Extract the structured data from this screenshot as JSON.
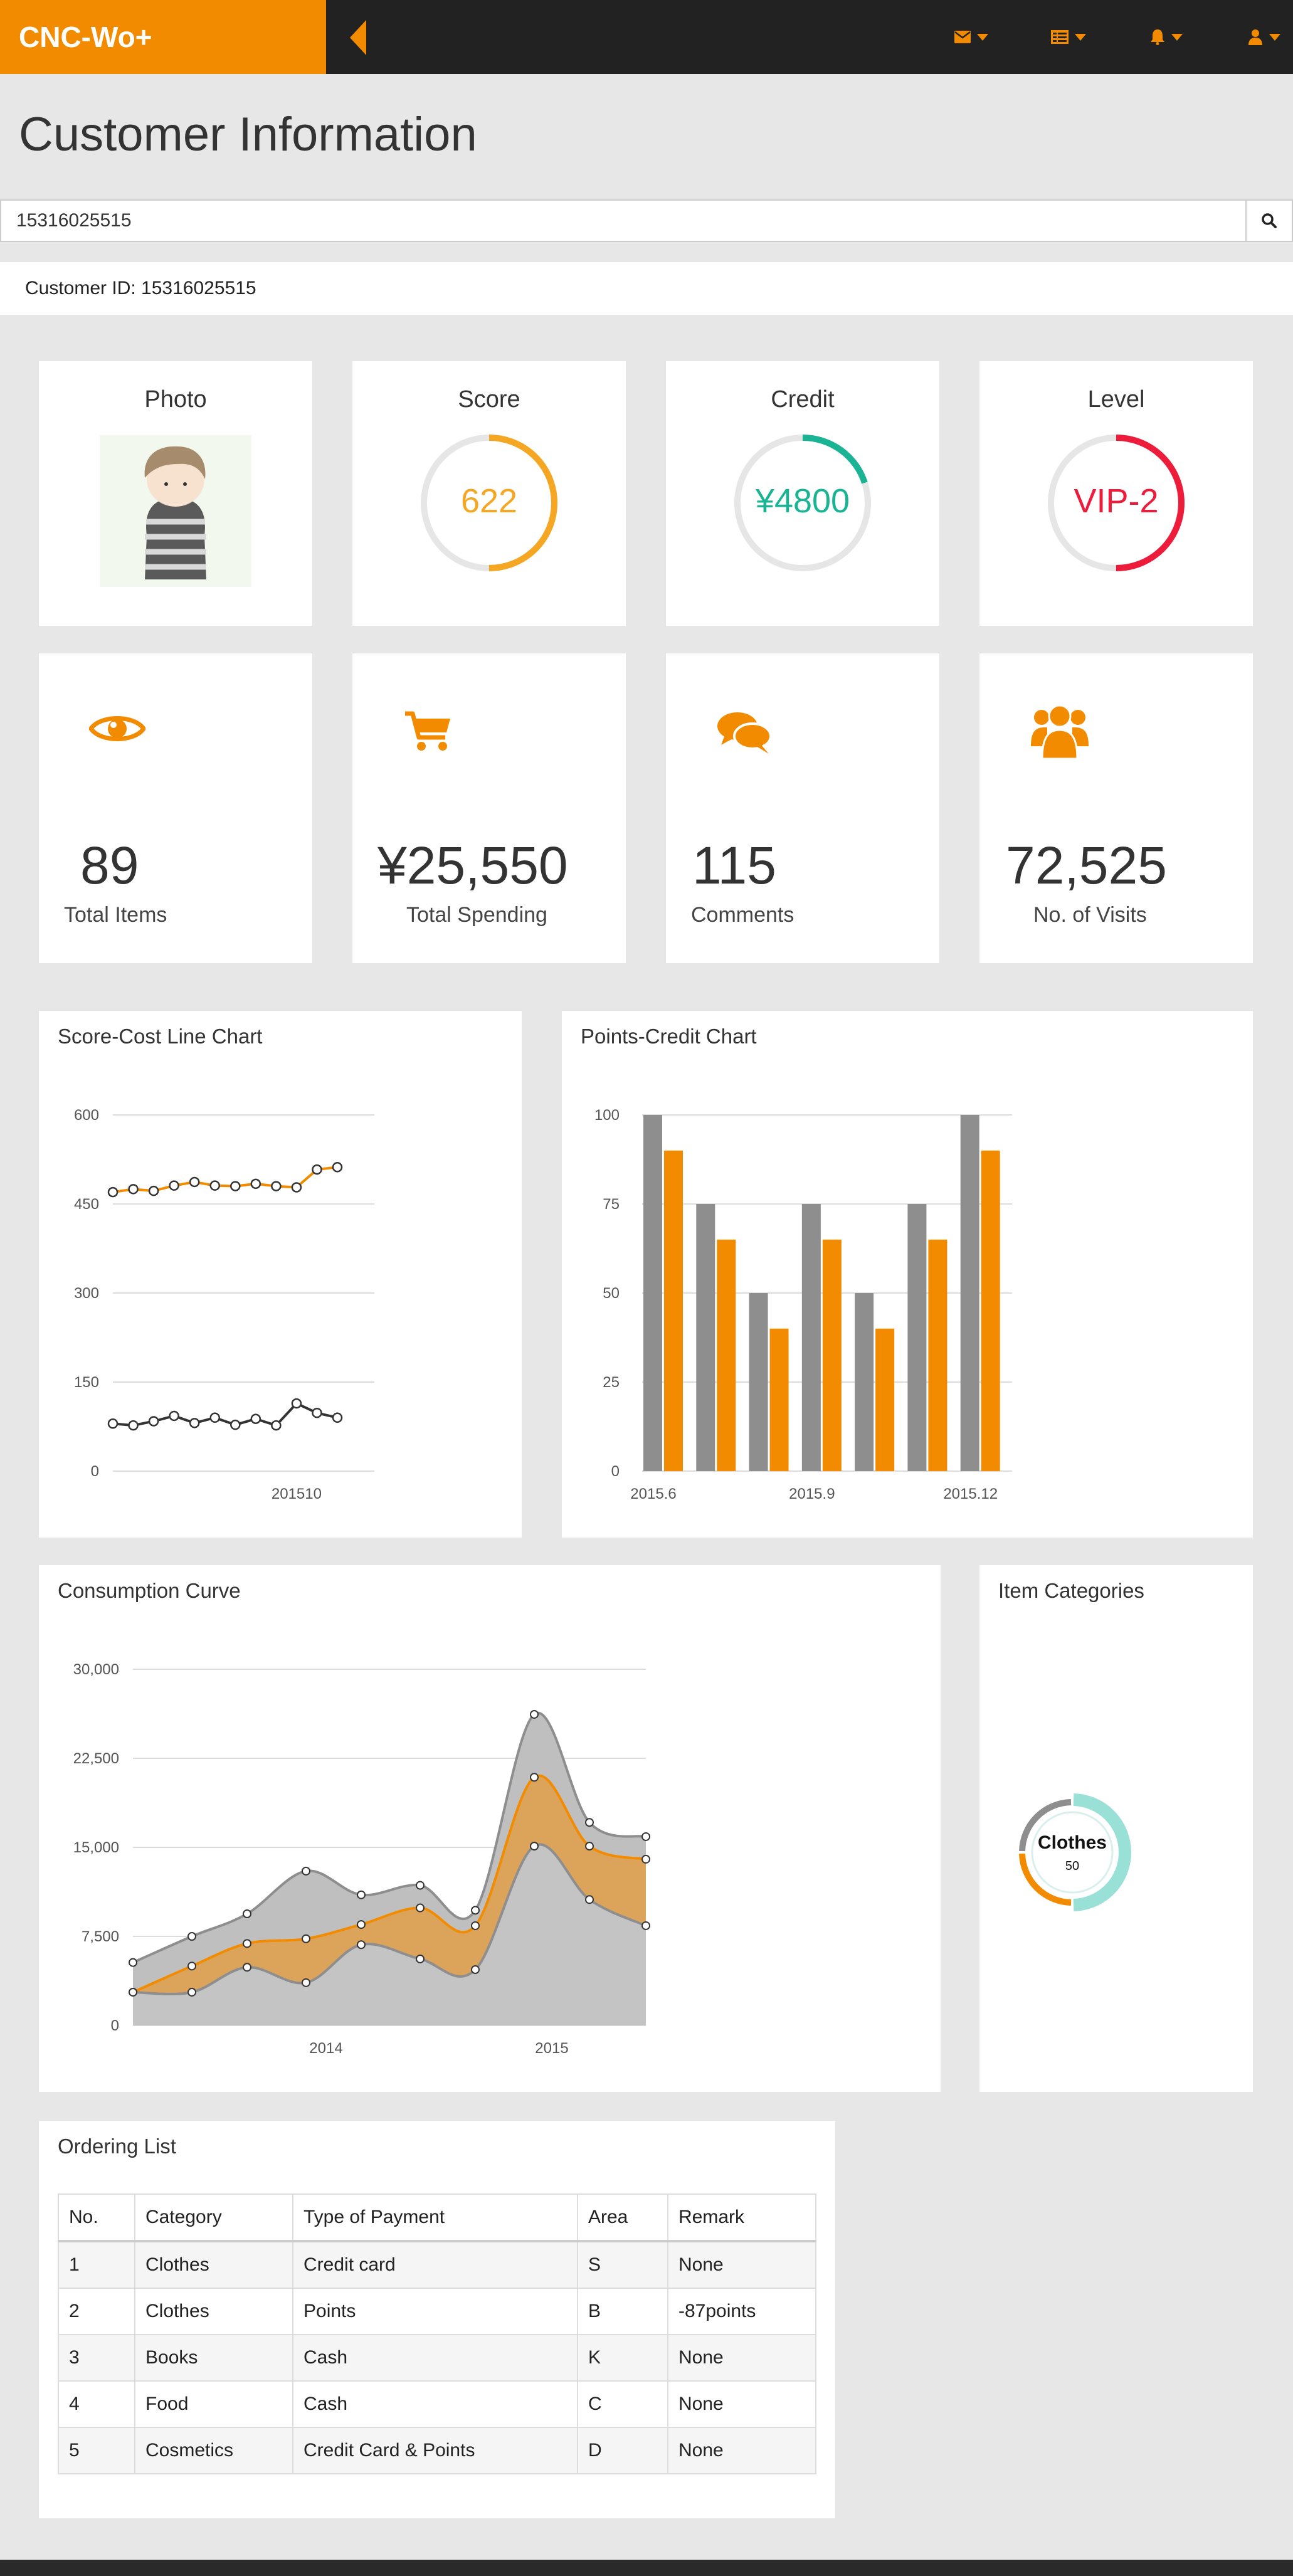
{
  "app": {
    "brand": "CNC-Wo+"
  },
  "nav": {
    "icons": [
      "envelope-icon",
      "list-icon",
      "bell-icon",
      "user-icon"
    ]
  },
  "page": {
    "title": "Customer Information"
  },
  "search": {
    "value": "15316025515"
  },
  "customer": {
    "id_text": "Customer ID: 15316025515"
  },
  "stats": {
    "photo": {
      "label": "Photo"
    },
    "score": {
      "label": "Score",
      "value": "622",
      "fraction": 0.5,
      "color": "#f5a623"
    },
    "credit": {
      "label": "Credit",
      "value": "¥4800",
      "fraction": 0.2,
      "color": "#1ab394"
    },
    "level": {
      "label": "Level",
      "value": "VIP-2",
      "fraction": 0.5,
      "color": "#ed1c3b"
    }
  },
  "metrics": [
    {
      "icon": "eye-icon",
      "value": "89",
      "label": "Total Items"
    },
    {
      "icon": "shopping-cart-icon",
      "value": "¥25,550",
      "label": "Total Spending"
    },
    {
      "icon": "comments-icon",
      "value": "115",
      "label": "Comments"
    },
    {
      "icon": "users-icon",
      "value": "72,525",
      "label": "No. of Visits"
    }
  ],
  "colors": {
    "accent": "#f28b00",
    "gray": "#8e8e8e",
    "dark": "#222222"
  },
  "chart_data": [
    {
      "type": "line",
      "title": "Score-Cost Line Chart",
      "ylim": [
        0,
        600
      ],
      "yticks": [
        0,
        150,
        300,
        450,
        600
      ],
      "xtick_labels": [
        {
          "index": 9,
          "label": "201510"
        }
      ],
      "series": [
        {
          "color": "#f28b00",
          "values": [
            470,
            475,
            472,
            481,
            487,
            481,
            480,
            484,
            480,
            478,
            508,
            512
          ]
        },
        {
          "color": "#333333",
          "values": [
            80,
            77,
            84,
            93,
            81,
            90,
            78,
            88,
            77,
            114,
            98,
            90
          ]
        }
      ]
    },
    {
      "type": "bar",
      "title": "Points-Credit Chart",
      "ylim": [
        0,
        100
      ],
      "yticks": [
        0,
        25,
        50,
        75,
        100
      ],
      "categories": [
        "2015.6",
        "",
        "",
        "2015.9",
        "",
        "",
        "2015.12"
      ],
      "series": [
        {
          "color": "#8e8e8e",
          "values": [
            100,
            75,
            50,
            75,
            50,
            75,
            100
          ]
        },
        {
          "color": "#f28b00",
          "values": [
            90,
            65,
            40,
            65,
            40,
            65,
            90
          ]
        }
      ]
    },
    {
      "type": "area",
      "title": "Consumption Curve",
      "ylim": [
        0,
        30000
      ],
      "yticks": [
        0,
        7500,
        15000,
        22500,
        30000
      ],
      "xtick_labels": [
        "2014",
        "2015"
      ],
      "series": [
        {
          "color": "#8e8e8e",
          "values": [
            5300,
            7500,
            9400,
            13000,
            11000,
            11800,
            9700,
            26200,
            17100,
            15900
          ]
        },
        {
          "color": "#f28b00",
          "values": [
            2800,
            5000,
            6900,
            7300,
            8500,
            9900,
            8400,
            20900,
            15100,
            14000
          ]
        },
        {
          "color": "#8e8e8e",
          "values": [
            2800,
            2800,
            4900,
            3600,
            6800,
            5600,
            4700,
            15100,
            10600,
            8400
          ]
        }
      ]
    },
    {
      "type": "pie",
      "title": "Item Categories",
      "center_label": "Clothes",
      "center_value": "50",
      "slices": [
        {
          "value": 50,
          "color": "#99e0d6"
        },
        {
          "value": 25,
          "color": "#f28b00"
        },
        {
          "value": 25,
          "color": "#8e8e8e"
        }
      ]
    }
  ],
  "orders": {
    "title": "Ordering List",
    "columns": [
      "No.",
      "Category",
      "Type of Payment",
      "Area",
      "Remark"
    ],
    "rows": [
      [
        "1",
        "Clothes",
        "Credit card",
        "S",
        "None"
      ],
      [
        "2",
        "Clothes",
        "Points",
        "B",
        "-87points"
      ],
      [
        "3",
        "Books",
        "Cash",
        "K",
        "None"
      ],
      [
        "4",
        "Food",
        "Cash",
        "C",
        "None"
      ],
      [
        "5",
        "Cosmetics",
        "Credit Card & Points",
        "D",
        "None"
      ]
    ]
  }
}
